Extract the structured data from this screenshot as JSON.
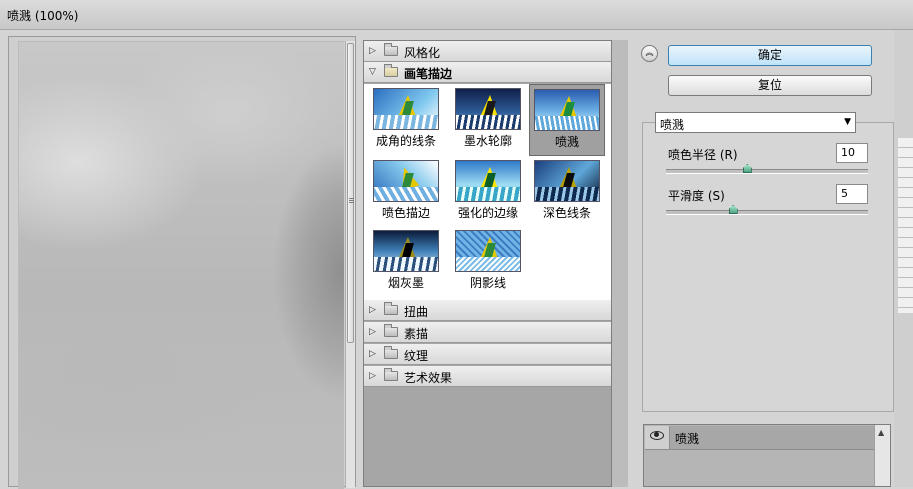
{
  "window": {
    "title": "喷溅 (100%)"
  },
  "gallery": {
    "categories_top": [
      {
        "label": "风格化",
        "open": false
      },
      {
        "label": "画笔描边",
        "open": true
      }
    ],
    "thumbnails": [
      {
        "label": "成角的线条"
      },
      {
        "label": "墨水轮廓"
      },
      {
        "label": "喷溅",
        "selected": true
      },
      {
        "label": "喷色描边"
      },
      {
        "label": "强化的边缘"
      },
      {
        "label": "深色线条"
      },
      {
        "label": "烟灰墨"
      },
      {
        "label": "阴影线"
      }
    ],
    "categories_bottom": [
      {
        "label": "扭曲"
      },
      {
        "label": "素描"
      },
      {
        "label": "纹理"
      },
      {
        "label": "艺术效果"
      }
    ]
  },
  "buttons": {
    "ok": "确定",
    "reset": "复位"
  },
  "filter_select": {
    "value": "喷溅"
  },
  "params": [
    {
      "label": "喷色半径 (R)",
      "value": "10",
      "slider_fraction": 0.4
    },
    {
      "label": "平滑度 (S)",
      "value": "5",
      "slider_fraction": 0.33
    }
  ],
  "layers": [
    {
      "name": "喷溅"
    }
  ],
  "icons": {
    "collapse": "double-chevron-up-icon",
    "folder": "folder-icon",
    "expand": "triangle-right-icon",
    "collapse_cat": "triangle-down-icon",
    "eye": "eye-icon",
    "select_arrow": "chevron-down-icon"
  },
  "colors": {
    "primary_button": "#bfe3f9",
    "slider_knob": "#4fa585"
  }
}
